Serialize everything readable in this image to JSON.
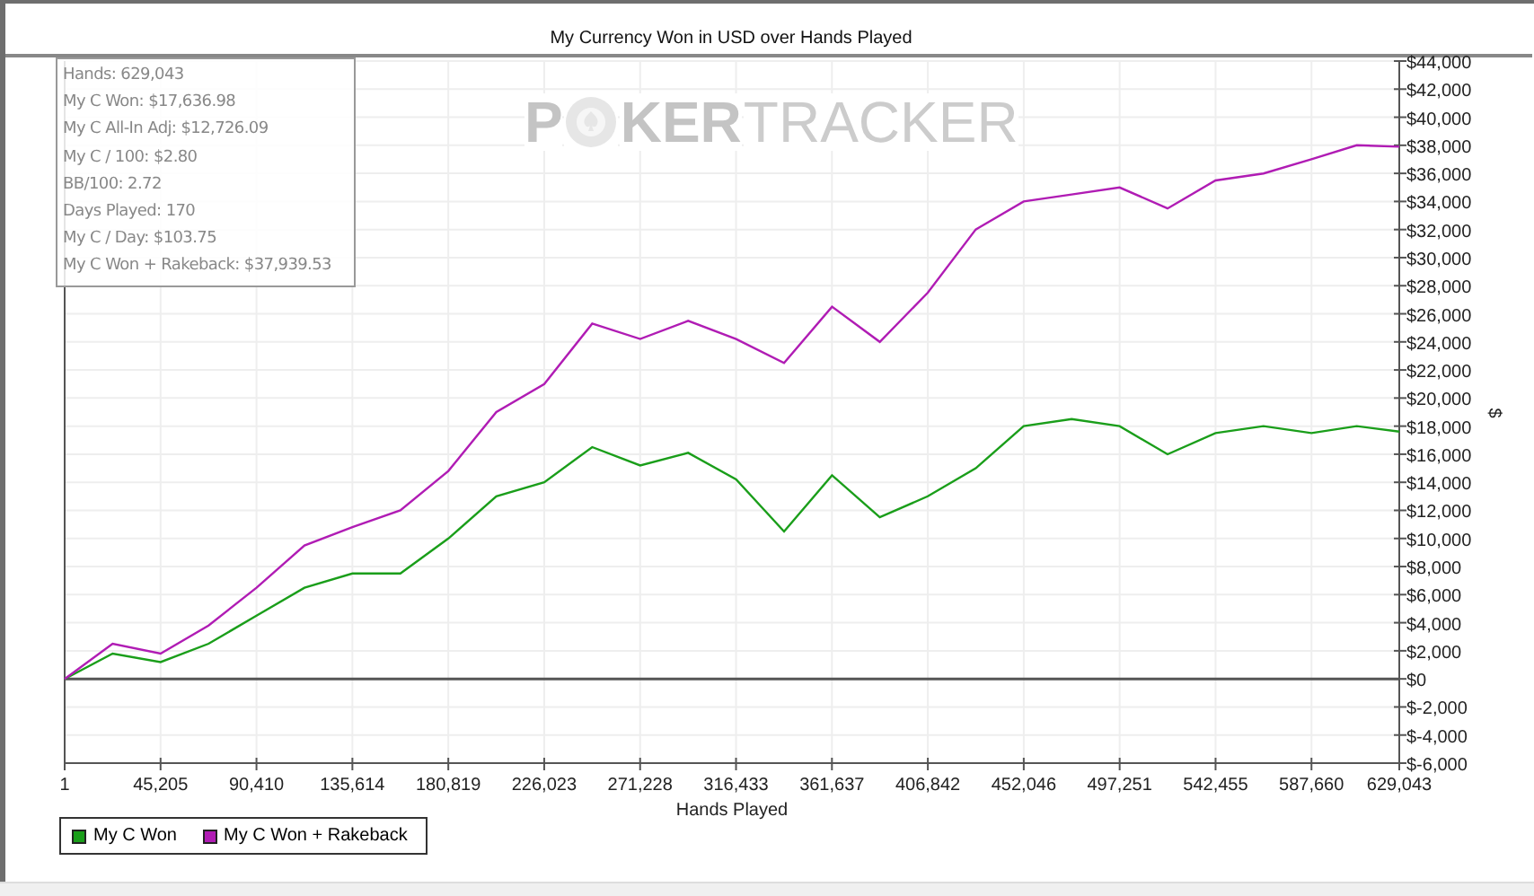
{
  "chart": {
    "title": "My Currency Won in USD over Hands Played",
    "logo": {
      "lead": "P",
      "bold": "KER",
      "light": "TRACKER"
    },
    "stats": [
      "Hands: 629,043",
      "My C Won: $17,636.98",
      "My C All-In Adj: $12,726.09",
      "My C / 100: $2.80",
      "BB/100: 2.72",
      "Days Played: 170",
      "My C / Day: $103.75",
      "My C Won + Rakeback: $37,939.53"
    ],
    "chart_data": {
      "type": "line",
      "grid": true,
      "xlabel": "Hands Played",
      "ylabel": "$",
      "x": [
        1,
        22602,
        45205,
        67807,
        90410,
        113012,
        135614,
        158217,
        180819,
        203421,
        226023,
        248625,
        271228,
        293830,
        316433,
        339035,
        361637,
        384240,
        406842,
        429444,
        452046,
        474649,
        497251,
        519853,
        542455,
        565058,
        587660,
        609000,
        629043
      ],
      "series": [
        {
          "name": "My C Won",
          "color": "#1a9e1a",
          "values": [
            0,
            1800,
            1200,
            2500,
            4500,
            6500,
            7500,
            7500,
            10000,
            13000,
            14000,
            16500,
            15200,
            16100,
            14200,
            10500,
            14500,
            11500,
            13000,
            15000,
            18000,
            18500,
            18000,
            16000,
            17500,
            18000,
            17500,
            18000,
            17600
          ]
        },
        {
          "name": "My C Won + Rakeback",
          "color": "#b01cb4",
          "values": [
            0,
            2500,
            1800,
            3800,
            6500,
            9500,
            10800,
            12000,
            14800,
            19000,
            21000,
            25300,
            24200,
            25500,
            24200,
            22500,
            26500,
            24000,
            27500,
            32000,
            34000,
            34500,
            35000,
            33500,
            35500,
            36000,
            37000,
            38000,
            37900
          ]
        }
      ],
      "xlim": [
        1,
        629043
      ],
      "ylim": [
        -6000,
        44000
      ],
      "xticks": [
        {
          "value": 1,
          "label": "1"
        },
        {
          "value": 45205,
          "label": "45,205"
        },
        {
          "value": 90410,
          "label": "90,410"
        },
        {
          "value": 135614,
          "label": "135,614"
        },
        {
          "value": 180819,
          "label": "180,819"
        },
        {
          "value": 226023,
          "label": "226,023"
        },
        {
          "value": 271228,
          "label": "271,228"
        },
        {
          "value": 316433,
          "label": "316,433"
        },
        {
          "value": 361637,
          "label": "361,637"
        },
        {
          "value": 406842,
          "label": "406,842"
        },
        {
          "value": 452046,
          "label": "452,046"
        },
        {
          "value": 497251,
          "label": "497,251"
        },
        {
          "value": 542455,
          "label": "542,455"
        },
        {
          "value": 587660,
          "label": "587,660"
        },
        {
          "value": 629043,
          "label": "629,043"
        }
      ],
      "yticks": [
        {
          "value": 44000,
          "label": "$44,000"
        },
        {
          "value": 42000,
          "label": "$42,000"
        },
        {
          "value": 40000,
          "label": "$40,000"
        },
        {
          "value": 38000,
          "label": "$38,000"
        },
        {
          "value": 36000,
          "label": "$36,000"
        },
        {
          "value": 34000,
          "label": "$34,000"
        },
        {
          "value": 32000,
          "label": "$32,000"
        },
        {
          "value": 30000,
          "label": "$30,000"
        },
        {
          "value": 28000,
          "label": "$28,000"
        },
        {
          "value": 26000,
          "label": "$26,000"
        },
        {
          "value": 24000,
          "label": "$24,000"
        },
        {
          "value": 22000,
          "label": "$22,000"
        },
        {
          "value": 20000,
          "label": "$20,000"
        },
        {
          "value": 18000,
          "label": "$18,000"
        },
        {
          "value": 16000,
          "label": "$16,000"
        },
        {
          "value": 14000,
          "label": "$14,000"
        },
        {
          "value": 12000,
          "label": "$12,000"
        },
        {
          "value": 10000,
          "label": "$10,000"
        },
        {
          "value": 8000,
          "label": "$8,000"
        },
        {
          "value": 6000,
          "label": "$6,000"
        },
        {
          "value": 4000,
          "label": "$4,000"
        },
        {
          "value": 2000,
          "label": "$2,000"
        },
        {
          "value": 0,
          "label": "$0"
        },
        {
          "value": -2000,
          "label": "$-2,000"
        },
        {
          "value": -4000,
          "label": "$-4,000"
        },
        {
          "value": -6000,
          "label": "$-6,000"
        }
      ]
    }
  }
}
